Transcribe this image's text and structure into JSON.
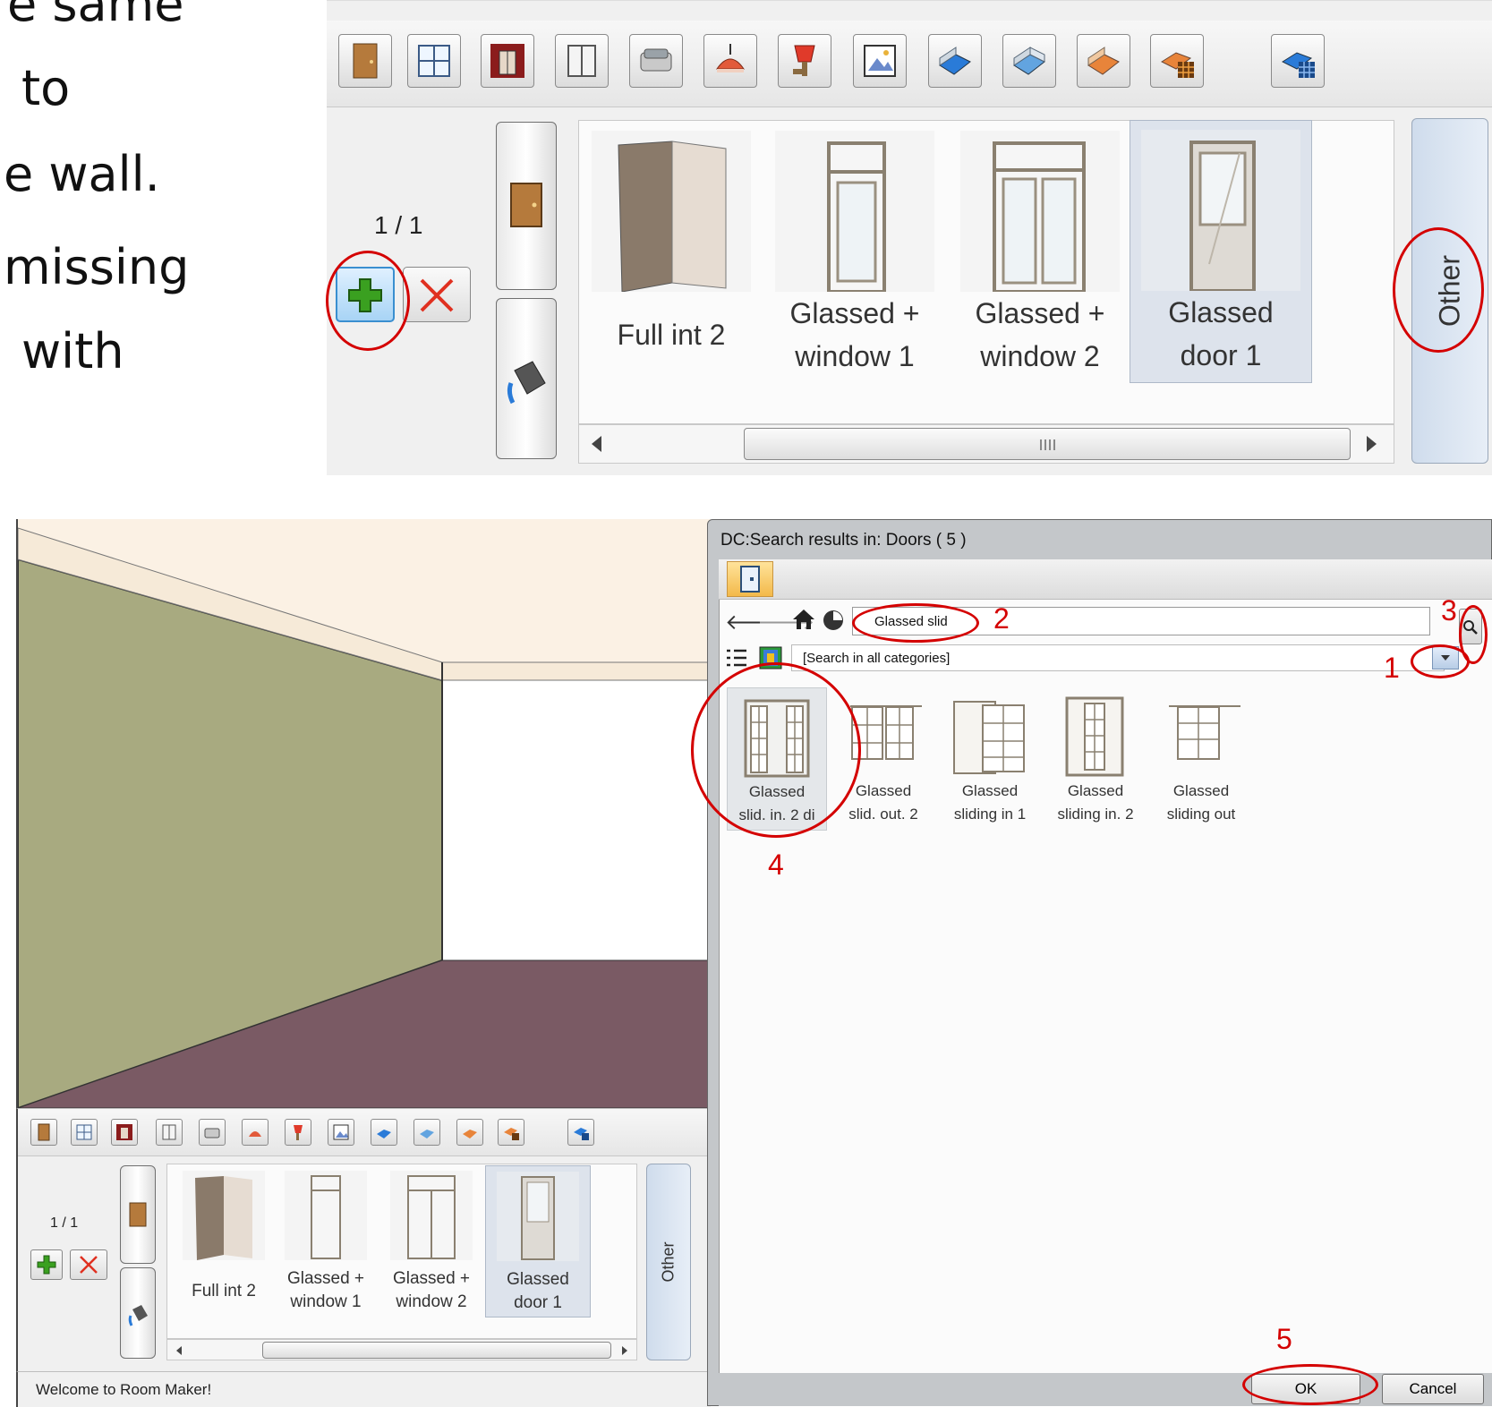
{
  "slide_text": {
    "line1": "e same",
    "line2": "to",
    "line3": "e wall.",
    "line4": "missing",
    "line5": "with"
  },
  "catalog_panel": {
    "page_indicator": "1 / 1",
    "toolbar_icons": [
      "door-icon",
      "window-icon",
      "wall-texture-icon",
      "cabinet-icon",
      "sofa-icon",
      "ceiling-lamp-icon",
      "wall-lamp-icon",
      "picture-icon",
      "floor-plan-icon",
      "floor-plan-2-icon",
      "room-orange-icon",
      "room-grid-icon",
      "room-blue-grid-icon"
    ],
    "tiles": [
      {
        "label_line1": "Full int 2",
        "label_line2": ""
      },
      {
        "label_line1": "Glassed +",
        "label_line2": "window 1"
      },
      {
        "label_line1": "Glassed +",
        "label_line2": "window 2"
      },
      {
        "label_line1": "Glassed",
        "label_line2": "door 1"
      }
    ],
    "other_tab": "Other"
  },
  "dialog": {
    "title": "DC:Search results in: Doors ( 5 )",
    "search_value": "Glassed slid",
    "category": "[Search in all categories]",
    "results": [
      {
        "line1": "Glassed",
        "line2": "slid. in. 2 di"
      },
      {
        "line1": "Glassed",
        "line2": "slid. out. 2"
      },
      {
        "line1": "Glassed",
        "line2": "sliding in 1"
      },
      {
        "line1": "Glassed",
        "line2": "sliding in. 2"
      },
      {
        "line1": "Glassed",
        "line2": "sliding out"
      }
    ],
    "ok_label": "OK",
    "cancel_label": "Cancel"
  },
  "annotations": {
    "n1": "1",
    "n2": "2",
    "n3": "3",
    "n4": "4",
    "n5": "5"
  },
  "status_bar": {
    "text": "Welcome to Room Maker!"
  },
  "colors": {
    "annotation_red": "#d40000",
    "wall_left": "#a8aa80",
    "floor": "#7a5a64",
    "ceiling": "#fbf1e4",
    "selection": "#dde3ec"
  }
}
